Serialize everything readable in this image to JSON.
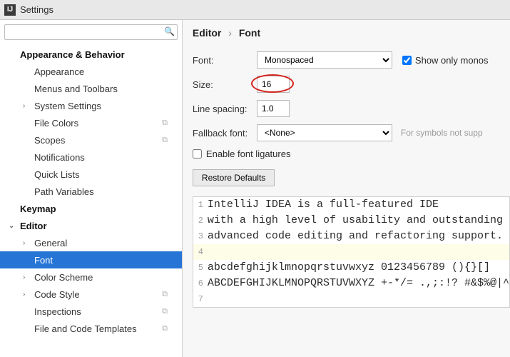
{
  "titlebar": {
    "title": "Settings"
  },
  "sidebar": {
    "search_placeholder": "",
    "items": [
      {
        "label": "Appearance & Behavior",
        "level": 1,
        "chev": "",
        "copy": false
      },
      {
        "label": "Appearance",
        "level": 2,
        "chev": "",
        "copy": false
      },
      {
        "label": "Menus and Toolbars",
        "level": 2,
        "chev": "",
        "copy": false
      },
      {
        "label": "System Settings",
        "level": 2,
        "chev": ">",
        "copy": false
      },
      {
        "label": "File Colors",
        "level": 2,
        "chev": "",
        "copy": true
      },
      {
        "label": "Scopes",
        "level": 2,
        "chev": "",
        "copy": true
      },
      {
        "label": "Notifications",
        "level": 2,
        "chev": "",
        "copy": false
      },
      {
        "label": "Quick Lists",
        "level": 2,
        "chev": "",
        "copy": false
      },
      {
        "label": "Path Variables",
        "level": 2,
        "chev": "",
        "copy": false
      },
      {
        "label": "Keymap",
        "level": 1,
        "chev": "",
        "copy": false
      },
      {
        "label": "Editor",
        "level": 1,
        "chev": "v",
        "copy": false
      },
      {
        "label": "General",
        "level": 2,
        "chev": ">",
        "copy": false
      },
      {
        "label": "Font",
        "level": 2,
        "chev": "",
        "copy": false,
        "selected": true
      },
      {
        "label": "Color Scheme",
        "level": 2,
        "chev": ">",
        "copy": false
      },
      {
        "label": "Code Style",
        "level": 2,
        "chev": ">",
        "copy": true
      },
      {
        "label": "Inspections",
        "level": 2,
        "chev": "",
        "copy": true
      },
      {
        "label": "File and Code Templates",
        "level": 2,
        "chev": "",
        "copy": true
      }
    ]
  },
  "breadcrumb": {
    "root": "Editor",
    "leaf": "Font"
  },
  "form": {
    "font_label": "Font:",
    "font_value": "Monospaced",
    "show_only_label": "Show only monos",
    "show_only_checked": true,
    "size_label": "Size:",
    "size_value": "16",
    "ls_label": "Line spacing:",
    "ls_value": "1.0",
    "fallback_label": "Fallback font:",
    "fallback_value": "<None>",
    "fallback_hint": "For symbols not supp",
    "ligatures_label": "Enable font ligatures",
    "ligatures_checked": false,
    "restore_label": "Restore Defaults"
  },
  "preview": {
    "lines": [
      "IntelliJ IDEA is a full-featured IDE",
      "with a high level of usability and outstanding",
      "advanced code editing and refactoring support.",
      "",
      "abcdefghijklmnopqrstuvwxyz 0123456789 (){}[]",
      "ABCDEFGHIJKLMNOPQRSTUVWXYZ +-*/= .,;:!? #&$%@|^",
      ""
    ],
    "current_line": 4
  }
}
